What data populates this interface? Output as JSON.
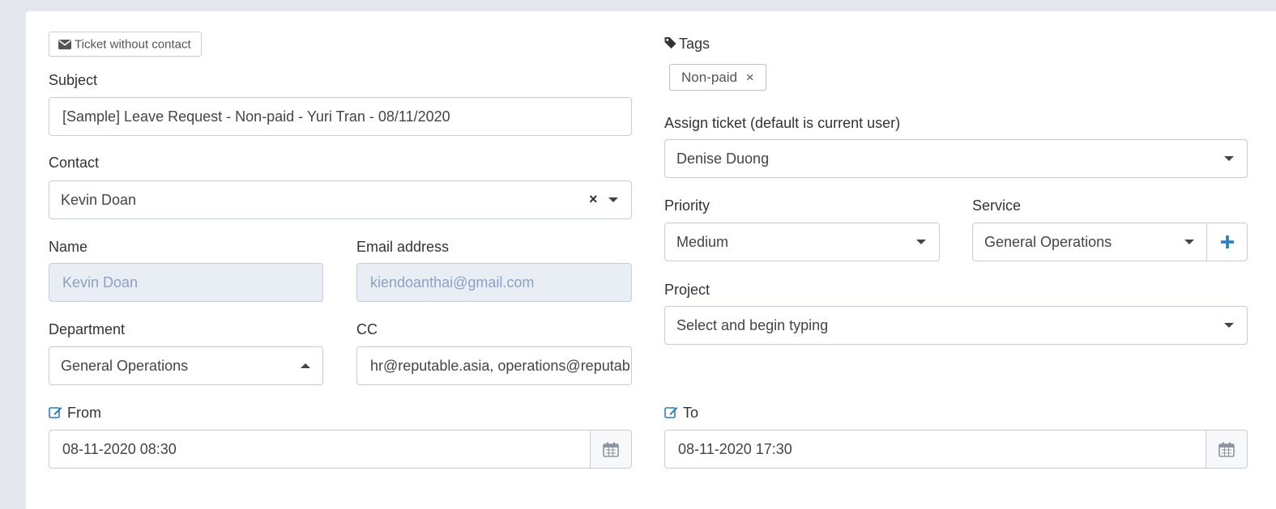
{
  "left": {
    "ticket_without_contact": "Ticket without contact",
    "subject_label": "Subject",
    "subject_value": "[Sample] Leave Request - Non-paid - Yuri Tran - 08/11/2020",
    "contact_label": "Contact",
    "contact_value": "Kevin Doan",
    "contact_clear": "×",
    "name_label": "Name",
    "name_value": "Kevin Doan",
    "email_label": "Email address",
    "email_value": "kiendoanthai@gmail.com",
    "department_label": "Department",
    "department_value": "General Operations",
    "cc_label": "CC",
    "cc_value": "hr@reputable.asia, operations@reputable.asia",
    "from_label": "From",
    "from_value": "08-11-2020 08:30"
  },
  "right": {
    "tags_label": "Tags",
    "tags": [
      {
        "label": "Non-paid",
        "remove": "×"
      }
    ],
    "assign_label": "Assign ticket (default is current user)",
    "assign_value": "Denise Duong",
    "priority_label": "Priority",
    "priority_value": "Medium",
    "service_label": "Service",
    "service_value": "General Operations",
    "service_add": "+",
    "project_label": "Project",
    "project_placeholder": "Select and begin typing",
    "to_label": "To",
    "to_value": "08-11-2020 17:30"
  },
  "icons": {
    "envelope": "envelope-icon",
    "tag": "tag-icon",
    "edit": "edit-icon",
    "calendar": "calendar-icon",
    "plus": "plus-icon"
  },
  "colors": {
    "accent": "#2a7cc1",
    "readonly_bg": "#e9eef5",
    "readonly_text": "#8aa1c1",
    "border": "#c6cdd6"
  }
}
